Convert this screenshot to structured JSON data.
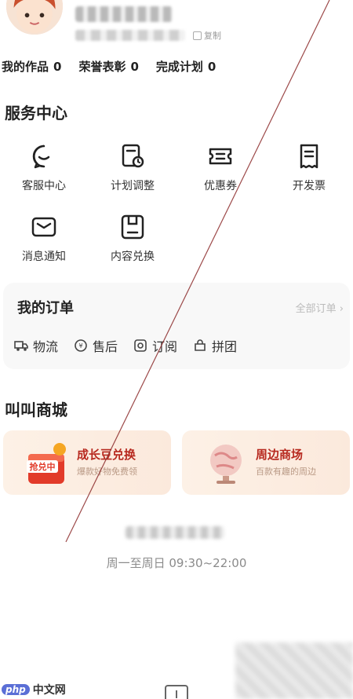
{
  "profile": {
    "copy_label": "复制"
  },
  "stats": [
    {
      "label": "我的作品",
      "value": "0"
    },
    {
      "label": "荣誉表彰",
      "value": "0"
    },
    {
      "label": "完成计划",
      "value": "0"
    }
  ],
  "service_center": {
    "title": "服务中心",
    "items": [
      {
        "label": "客服中心",
        "icon": "chat-bubble-icon"
      },
      {
        "label": "计划调整",
        "icon": "schedule-adjust-icon"
      },
      {
        "label": "优惠券",
        "icon": "coupon-icon"
      },
      {
        "label": "开发票",
        "icon": "invoice-icon"
      },
      {
        "label": "消息通知",
        "icon": "mail-icon"
      },
      {
        "label": "内容兑换",
        "icon": "content-redeem-icon"
      }
    ]
  },
  "orders": {
    "title": "我的订单",
    "all_label": "全部订单 ›",
    "items": [
      {
        "label": "物流",
        "icon": "truck-icon"
      },
      {
        "label": "售后",
        "icon": "after-sale-icon"
      },
      {
        "label": "订阅",
        "icon": "subscribe-icon"
      },
      {
        "label": "拼团",
        "icon": "group-buy-icon"
      }
    ]
  },
  "shop": {
    "title": "叫叫商城",
    "cards": [
      {
        "title": "成长豆兑换",
        "subtitle": "爆款好物免费领",
        "badge": "抢兑中"
      },
      {
        "title": "周边商场",
        "subtitle": "百款有趣的周边"
      }
    ]
  },
  "footer": {
    "hours": "周一至周日 09:30~22:00"
  },
  "watermark": {
    "php": "php",
    "text": "中文网"
  },
  "colors": {
    "accent_red": "#b7291f",
    "muted_text": "#8b8b8b"
  }
}
